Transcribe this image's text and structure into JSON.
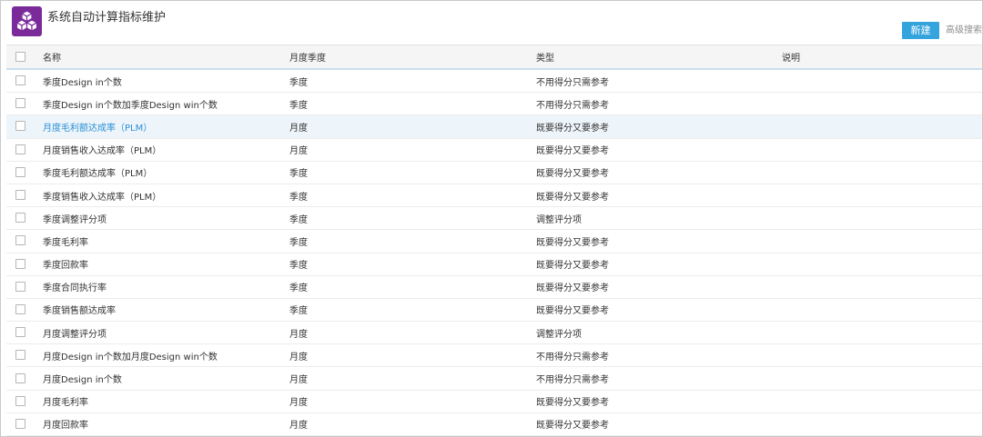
{
  "header": {
    "title": "系统自动计算指标维护",
    "new_button": "新建",
    "advanced_search": "高级搜索"
  },
  "table": {
    "columns": [
      "名称",
      "月度季度",
      "类型",
      "说明"
    ],
    "rows": [
      {
        "name": "季度Design in个数",
        "period": "季度",
        "type": "不用得分只需参考",
        "desc": ""
      },
      {
        "name": "季度Design in个数加季度Design win个数",
        "period": "季度",
        "type": "不用得分只需参考",
        "desc": ""
      },
      {
        "name": "月度毛利额达成率（PLM）",
        "period": "月度",
        "type": "既要得分又要参考",
        "desc": "",
        "highlighted": true
      },
      {
        "name": "月度销售收入达成率（PLM）",
        "period": "月度",
        "type": "既要得分又要参考",
        "desc": ""
      },
      {
        "name": "季度毛利额达成率（PLM）",
        "period": "季度",
        "type": "既要得分又要参考",
        "desc": ""
      },
      {
        "name": "季度销售收入达成率（PLM）",
        "period": "季度",
        "type": "既要得分又要参考",
        "desc": ""
      },
      {
        "name": "季度调整评分项",
        "period": "季度",
        "type": "调整评分项",
        "desc": ""
      },
      {
        "name": "季度毛利率",
        "period": "季度",
        "type": "既要得分又要参考",
        "desc": ""
      },
      {
        "name": "季度回款率",
        "period": "季度",
        "type": "既要得分又要参考",
        "desc": ""
      },
      {
        "name": "季度合同执行率",
        "period": "季度",
        "type": "既要得分又要参考",
        "desc": ""
      },
      {
        "name": "季度销售额达成率",
        "period": "季度",
        "type": "既要得分又要参考",
        "desc": ""
      },
      {
        "name": "月度调整评分项",
        "period": "月度",
        "type": "调整评分项",
        "desc": ""
      },
      {
        "name": "月度Design in个数加月度Design win个数",
        "period": "月度",
        "type": "不用得分只需参考",
        "desc": ""
      },
      {
        "name": "月度Design in个数",
        "period": "月度",
        "type": "不用得分只需参考",
        "desc": ""
      },
      {
        "name": "月度毛利率",
        "period": "月度",
        "type": "既要得分又要参考",
        "desc": ""
      },
      {
        "name": "月度回款率",
        "period": "月度",
        "type": "既要得分又要参考",
        "desc": ""
      }
    ]
  },
  "colors": {
    "logo": "#7b2a9a",
    "primary_button": "#35a4dd",
    "link": "#2a8fd6",
    "row_highlight": "#eef5fa"
  }
}
